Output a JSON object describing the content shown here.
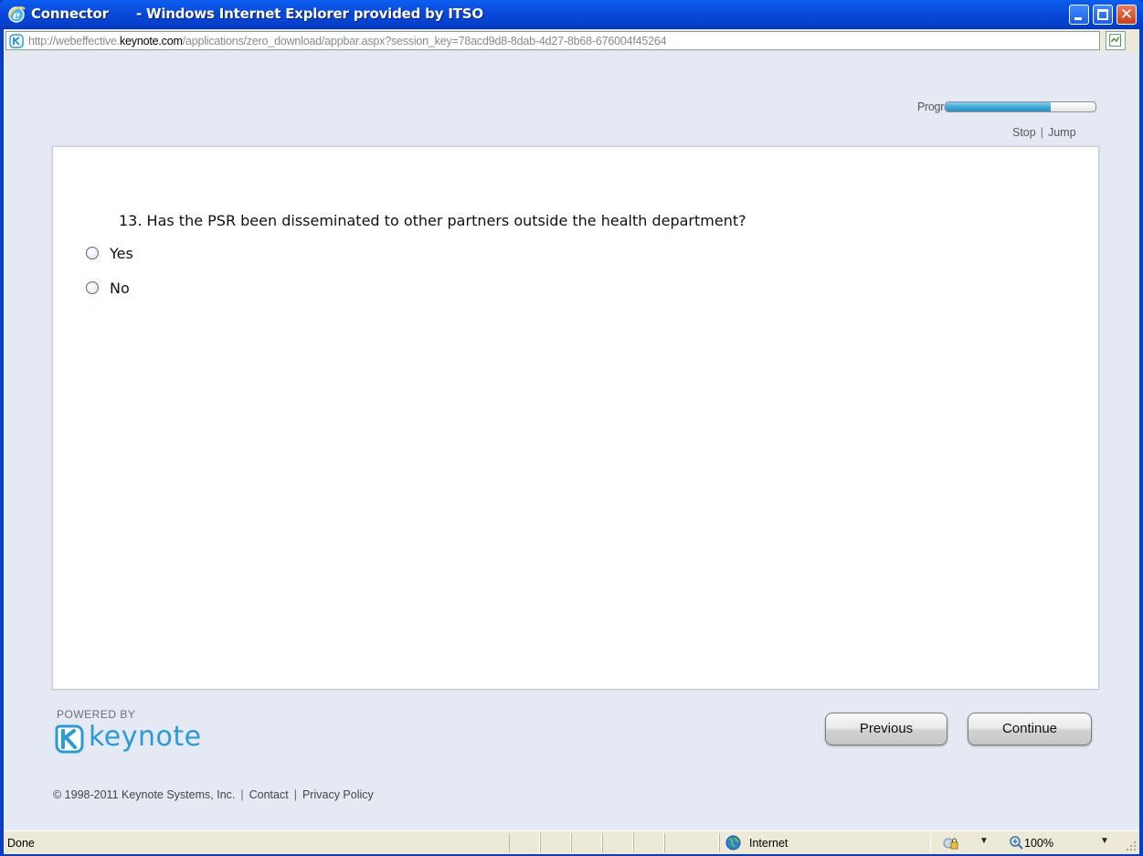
{
  "window": {
    "title": "Connector      - Windows Internet Explorer provided by ITSO"
  },
  "address": {
    "url_prefix": "http://webeffective.",
    "url_domain": "keynote.com",
    "url_suffix": "/applications/zero_download/appbar.aspx?session_key=78acd9d8-8dab-4d27-8b68-676004f45264"
  },
  "toolbar": {
    "progress_label": "Progress",
    "progress_fraction": 0.7,
    "stop_label": "Stop",
    "jump_label": "Jump",
    "separator": "|"
  },
  "question": {
    "text": "13. Has the PSR been disseminated to other partners outside the health department?",
    "options": [
      "Yes",
      "No"
    ]
  },
  "footer": {
    "powered_by": "POWERED BY",
    "logo_text": "keynote",
    "copyright": "© 1998-2011 Keynote Systems, Inc.",
    "contact": "Contact",
    "privacy": "Privacy Policy",
    "separator": "|"
  },
  "nav": {
    "previous_label": "Previous",
    "continue_label": "Continue"
  },
  "statusbar": {
    "status": "Done",
    "zone": "Internet",
    "zoom": "100%"
  },
  "colors": {
    "titlebar": "#0a5ef0",
    "content_background": "#e4e9f3",
    "brand": "#2a9bd6",
    "progress_fill": "#3aa4d4"
  },
  "icons": [
    "ie-icon",
    "keynote-favicon-icon",
    "compatibility-view-icon",
    "globe-icon",
    "protected-mode-icon",
    "zoom-icon",
    "resize-grip-icon"
  ]
}
